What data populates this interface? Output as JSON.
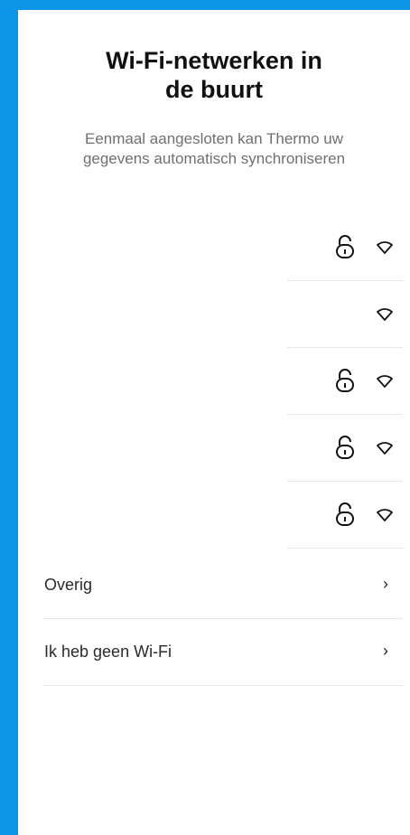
{
  "header": {
    "title_line1": "Wi-Fi-netwerken in",
    "title_line2": "de buurt",
    "subtitle_line1": "Eenmaal aangesloten kan Thermo uw",
    "subtitle_line2": "gegevens automatisch synchroniseren"
  },
  "networks": [
    {
      "secured": true,
      "icon": "wifi-icon"
    },
    {
      "secured": false,
      "icon": "wifi-icon"
    },
    {
      "secured": true,
      "icon": "wifi-icon"
    },
    {
      "secured": true,
      "icon": "wifi-icon"
    },
    {
      "secured": true,
      "icon": "wifi-icon"
    }
  ],
  "options": {
    "other_label": "Overig",
    "no_wifi_label": "Ik heb geen Wi-Fi",
    "chevron": "›"
  },
  "colors": {
    "background": "#0c95e4",
    "panel": "#ffffff",
    "text": "#111111",
    "muted": "#6f6f6f",
    "divider": "#e8e8e8"
  }
}
